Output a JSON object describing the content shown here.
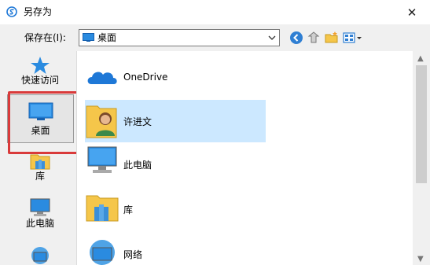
{
  "window": {
    "title": "另存为",
    "close_glyph": "✕"
  },
  "savebar": {
    "label": "保存在(I):",
    "location": "桌面",
    "icons": [
      "back-icon",
      "up-folder-icon",
      "new-folder-icon",
      "view-menu-icon"
    ]
  },
  "places": [
    {
      "label": "快速访问",
      "icon": "quick-access-star-icon",
      "selected": false
    },
    {
      "label": "桌面",
      "icon": "desktop-icon",
      "selected": true
    },
    {
      "label": "库",
      "icon": "library-icon",
      "selected": false
    },
    {
      "label": "此电脑",
      "icon": "computer-icon",
      "selected": false
    },
    {
      "label": "",
      "icon": "network-icon",
      "selected": false
    }
  ],
  "files": [
    {
      "name": "OneDrive",
      "icon": "onedrive-cloud-icon",
      "selected": false
    },
    {
      "name": "许进文",
      "icon": "user-folder-icon",
      "selected": true
    },
    {
      "name": "此电脑",
      "icon": "computer-icon",
      "selected": false
    },
    {
      "name": "库",
      "icon": "library-icon",
      "selected": false
    },
    {
      "name": "网络",
      "icon": "network-icon",
      "selected": false
    }
  ],
  "colors": {
    "highlight": "#d93a3a",
    "selection": "#cce8ff",
    "accent": "#1e78d7"
  }
}
